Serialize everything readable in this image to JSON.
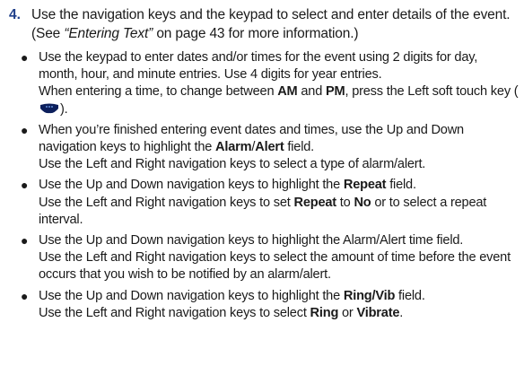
{
  "step": {
    "number": "4.",
    "text_before": "Use the navigation keys and the keypad to select and enter details of the event. (See ",
    "ref": "“Entering Text”",
    "text_after": " on page 43 for more information.)"
  },
  "bullets": {
    "b1": {
      "line1": "Use the keypad to enter dates and/or times for the event using 2 digits for day, month, hour, and minute entries. Use 4 digits for year entries.",
      "line2_a": "When entering a time, to change between ",
      "am": "AM",
      "and": " and ",
      "pm": "PM",
      "line2_b": ", press the Left soft touch key (",
      "line2_c": ")."
    },
    "b2": {
      "line1": "When you’re finished entering event dates and times, use the Up and Down navigation keys to highlight the ",
      "field": "Alarm",
      "slash": "/",
      "field2": "Alert",
      "field_suffix": " field.",
      "line2": "Use the Left and Right navigation keys to select a type of alarm/alert."
    },
    "b3": {
      "line1_a": "Use the Up and Down navigation keys to highlight the ",
      "field": "Repeat",
      "line1_b": " field.",
      "line2_a": "Use the Left and Right navigation keys to set ",
      "repeat": "Repeat",
      "to": " to ",
      "no": "No",
      "line2_b": " or to select a repeat interval."
    },
    "b4": {
      "line1": "Use the Up and Down navigation keys to highlight the Alarm/Alert time field.",
      "line2": "Use the Left and Right navigation keys to select the amount of time before the event occurs that you wish to be notified by an alarm/alert."
    },
    "b5": {
      "line1_a": "Use the Up and Down navigation keys to highlight the ",
      "field": "Ring/Vib",
      "line1_b": " field.",
      "line2_a": "Use the Left and Right navigation keys to select ",
      "ring": "Ring",
      "or": " or ",
      "vibrate": "Vibrate",
      "line2_b": "."
    }
  },
  "icons": {
    "soft_key": "left-soft-touch-key-icon"
  },
  "colors": {
    "step_number": "#1f3f8a",
    "key_icon": "#0c1f5c"
  }
}
